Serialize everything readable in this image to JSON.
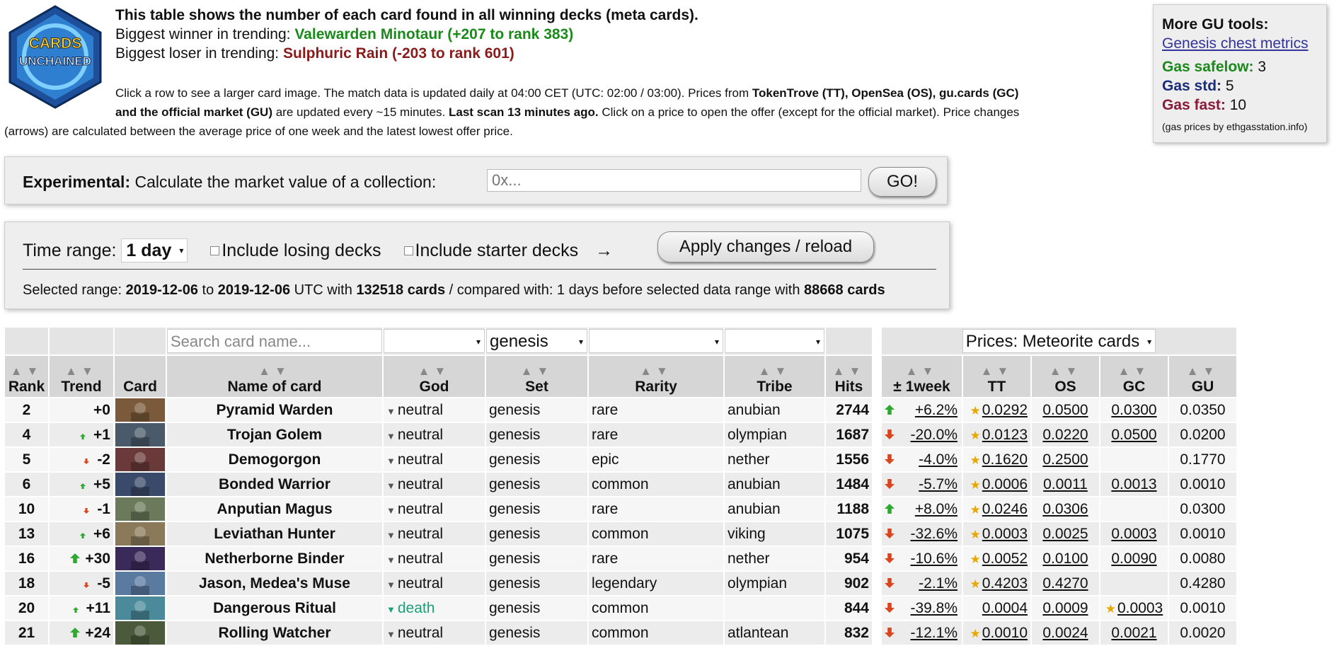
{
  "logo": {
    "line1": "CARDS",
    "line2": "UNCHAINED"
  },
  "intro": {
    "line1": "This table shows the number of each card found in all winning decks (meta cards).",
    "winner_label": "Biggest winner in trending:",
    "winner_value": "Valewarden Minotaur (+207 to rank 383)",
    "loser_label": "Biggest loser in trending:",
    "loser_value": "Sulphuric Rain (-203 to rank 601)"
  },
  "description": {
    "p1": "Click a row to see a larger card image. The match data is updated daily at 04:00 CET (UTC: 02:00 / 03:00). Prices from ",
    "b1": "TokenTrove (TT), OpenSea (OS), gu.cards (GC)",
    "p2": "and the official market (GU)",
    "p3": " are updated every ~15 minutes. ",
    "b2": "Last scan 13 minutes ago.",
    "p4": " Click on a price to open the offer (except for the official market). Price changes",
    "p5": "(arrows) are calculated between the average price of one week and the latest lowest offer price."
  },
  "tools": {
    "heading": "More GU tools:",
    "link": "Genesis chest metrics",
    "safelow_label": "Gas safelow:",
    "safelow": "3",
    "std_label": "Gas std:",
    "std": "5",
    "fast_label": "Gas fast:",
    "fast": "10",
    "source": "(gas prices by ethgasstation.info)"
  },
  "experimental": {
    "label_bold": "Experimental:",
    "label": " Calculate the market value of a collection:",
    "placeholder": "0x...",
    "go": "GO!"
  },
  "timerange": {
    "label": "Time range:",
    "value": "1 day",
    "losing": "Include losing decks",
    "starter": "Include starter decks",
    "arrow": "→",
    "apply": "Apply changes / reload",
    "sel_prefix": "Selected range: ",
    "from": "2019-12-06",
    "to_word": " to ",
    "to": "2019-12-06",
    "utc_with": " UTC with ",
    "cards": "132518 cards",
    "compared": " / compared with: 1 days before selected data range with ",
    "cards2": "88668 cards"
  },
  "filters": {
    "search_placeholder": "Search card name...",
    "set": "genesis",
    "prices": "Prices: Meteorite cards"
  },
  "headers": {
    "rank": "Rank",
    "trend": "Trend",
    "card": "Card",
    "name": "Name of card",
    "god": "God",
    "set": "Set",
    "rarity": "Rarity",
    "tribe": "Tribe",
    "hits": "Hits",
    "week": "± 1week",
    "tt": "TT",
    "os": "OS",
    "gc": "GC",
    "gu": "GU"
  },
  "rows": [
    {
      "rank": "2",
      "trend": "+0",
      "tdir": "none",
      "name": "Pyramid Warden",
      "god": "neutral",
      "set": "genesis",
      "rarity": "rare",
      "tribe": "anubian",
      "hits": "2744",
      "wdir": "up",
      "week": "+6.2%",
      "tt": "0.0292",
      "os": "0.0500",
      "gc": "0.0300",
      "gu": "0.0350",
      "star": "tt"
    },
    {
      "rank": "4",
      "trend": "+1",
      "tdir": "up-s",
      "name": "Trojan Golem",
      "god": "neutral",
      "set": "genesis",
      "rarity": "rare",
      "tribe": "olympian",
      "hits": "1687",
      "wdir": "down",
      "week": "-20.0%",
      "tt": "0.0123",
      "os": "0.0220",
      "gc": "0.0500",
      "gu": "0.0200",
      "star": "tt"
    },
    {
      "rank": "5",
      "trend": "-2",
      "tdir": "down-s",
      "name": "Demogorgon",
      "god": "neutral",
      "set": "genesis",
      "rarity": "epic",
      "tribe": "nether",
      "hits": "1556",
      "wdir": "down",
      "week": "-4.0%",
      "tt": "0.1620",
      "os": "0.2500",
      "gc": "",
      "gu": "0.1770",
      "star": "tt"
    },
    {
      "rank": "6",
      "trend": "+5",
      "tdir": "up-s",
      "name": "Bonded Warrior",
      "god": "neutral",
      "set": "genesis",
      "rarity": "common",
      "tribe": "anubian",
      "hits": "1484",
      "wdir": "down",
      "week": "-5.7%",
      "tt": "0.0006",
      "os": "0.0011",
      "gc": "0.0013",
      "gu": "0.0010",
      "star": "tt"
    },
    {
      "rank": "10",
      "trend": "-1",
      "tdir": "down-s",
      "name": "Anputian Magus",
      "god": "neutral",
      "set": "genesis",
      "rarity": "rare",
      "tribe": "anubian",
      "hits": "1188",
      "wdir": "up",
      "week": "+8.0%",
      "tt": "0.0246",
      "os": "0.0306",
      "gc": "",
      "gu": "0.0300",
      "star": "tt"
    },
    {
      "rank": "13",
      "trend": "+6",
      "tdir": "up-s",
      "name": "Leviathan Hunter",
      "god": "neutral",
      "set": "genesis",
      "rarity": "common",
      "tribe": "viking",
      "hits": "1075",
      "wdir": "down",
      "week": "-32.6%",
      "tt": "0.0003",
      "os": "0.0025",
      "gc": "0.0003",
      "gu": "0.0010",
      "star": "tt"
    },
    {
      "rank": "16",
      "trend": "+30",
      "tdir": "up",
      "name": "Netherborne Binder",
      "god": "neutral",
      "set": "genesis",
      "rarity": "rare",
      "tribe": "nether",
      "hits": "954",
      "wdir": "down",
      "week": "-10.6%",
      "tt": "0.0052",
      "os": "0.0100",
      "gc": "0.0090",
      "gu": "0.0080",
      "star": "tt"
    },
    {
      "rank": "18",
      "trend": "-5",
      "tdir": "down-s",
      "name": "Jason, Medea's Muse",
      "god": "neutral",
      "set": "genesis",
      "rarity": "legendary",
      "tribe": "olympian",
      "hits": "902",
      "wdir": "down",
      "week": "-2.1%",
      "tt": "0.4203",
      "os": "0.4270",
      "gc": "",
      "gu": "0.4280",
      "star": "tt"
    },
    {
      "rank": "20",
      "trend": "+11",
      "tdir": "up-s",
      "name": "Dangerous Ritual",
      "god": "death",
      "set": "genesis",
      "rarity": "common",
      "tribe": "",
      "hits": "844",
      "wdir": "down",
      "week": "-39.8%",
      "tt": "0.0004",
      "os": "0.0009",
      "gc": "0.0003",
      "gu": "0.0010",
      "star": "gc"
    },
    {
      "rank": "21",
      "trend": "+24",
      "tdir": "up",
      "name": "Rolling Watcher",
      "god": "neutral",
      "set": "genesis",
      "rarity": "common",
      "tribe": "atlantean",
      "hits": "832",
      "wdir": "down",
      "week": "-12.1%",
      "tt": "0.0010",
      "os": "0.0024",
      "gc": "0.0021",
      "gu": "0.0020",
      "star": "tt"
    }
  ],
  "colors": {
    "up": "#2fa82f",
    "down": "#d9461e",
    "thumbs": [
      "#7a5a3a",
      "#4a5a6a",
      "#6a3a3a",
      "#3a4a6a",
      "#6a7a5a",
      "#8a7a5a",
      "#3a2a5a",
      "#5a7aa0",
      "#4a8a9a",
      "#4a5a3a"
    ]
  }
}
